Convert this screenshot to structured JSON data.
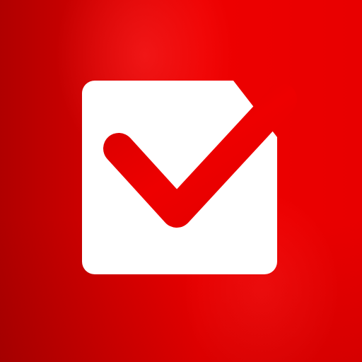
{
  "icon": {
    "name": "checkbox-checked",
    "background_color": "#e00000",
    "box_color": "#ffffff",
    "check_color": "#e00000"
  }
}
